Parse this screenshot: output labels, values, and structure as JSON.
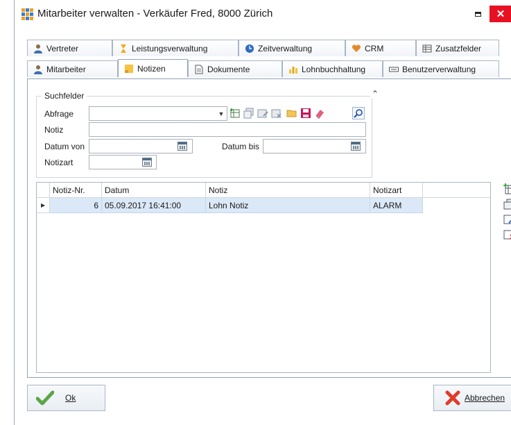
{
  "window": {
    "title": "Mitarbeiter verwalten - Verkäufer Fred, 8000 Zürich",
    "close_glyph": "✕"
  },
  "tabs_top": [
    {
      "label": "Vertreter",
      "icon": "person-icon"
    },
    {
      "label": "Leistungsverwaltung",
      "icon": "hourglass-icon"
    },
    {
      "label": "Zeitverwaltung",
      "icon": "clock-icon"
    },
    {
      "label": "CRM",
      "icon": "heart-icon"
    },
    {
      "label": "Zusatzfelder",
      "icon": "table-icon"
    }
  ],
  "tabs_bottom": [
    {
      "label": "Mitarbeiter",
      "icon": "person-icon"
    },
    {
      "label": "Notizen",
      "icon": "note-icon",
      "active": true
    },
    {
      "label": "Dokumente",
      "icon": "document-icon"
    },
    {
      "label": "Lohnbuchhaltung",
      "icon": "bar-chart-icon"
    },
    {
      "label": "Benutzerverwaltung",
      "icon": "keyboard-icon"
    }
  ],
  "search": {
    "legend": "Suchfelder",
    "abfrage_label": "Abfrage",
    "abfrage_value": "",
    "notiz_label": "Notiz",
    "notiz_value": "",
    "datum_von_label": "Datum von",
    "datum_von_value": "",
    "datum_bis_label": "Datum bis",
    "datum_bis_value": "",
    "notizart_label": "Notizart",
    "notizart_value": ""
  },
  "grid": {
    "columns": [
      "Notiz-Nr.",
      "Datum",
      "Notiz",
      "Notizart"
    ],
    "rows": [
      {
        "nr": "6",
        "datum": "05.09.2017 16:41:00",
        "notiz": "Lohn Notiz",
        "notizart": "ALARM"
      }
    ]
  },
  "footer": {
    "ok_label": "Ok",
    "cancel_label": "Abbrechen"
  },
  "colors": {
    "accent_blue": "#2b6cc4",
    "close_red": "#e81123",
    "selected_row": "#dbe8f7"
  }
}
